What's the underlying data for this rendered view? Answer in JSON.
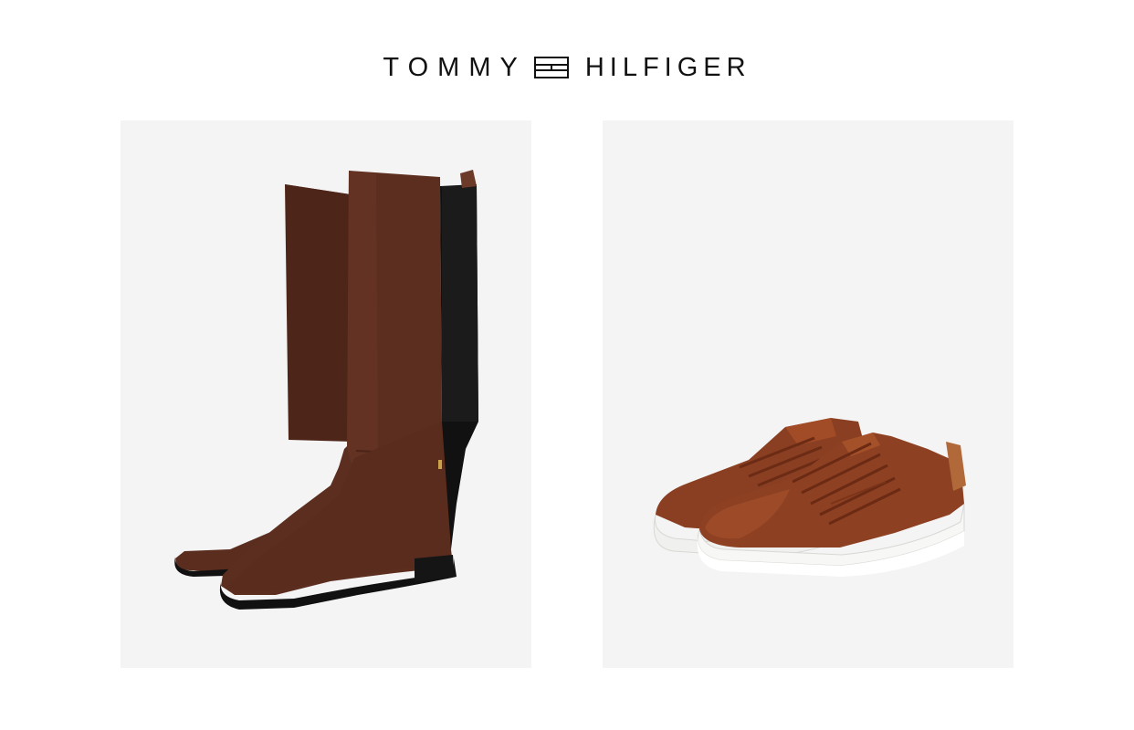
{
  "brand": {
    "left_word": "TOMMY",
    "right_word": "HILFIGER",
    "flag_colors": [
      "#ffffff",
      "#c8102e",
      "#002f6c"
    ]
  },
  "products": [
    {
      "image": "brown-suede-knee-high-boots",
      "background": "#f4f4f4"
    },
    {
      "image": "cognac-leather-sneakers",
      "background": "#f4f4f4"
    }
  ]
}
